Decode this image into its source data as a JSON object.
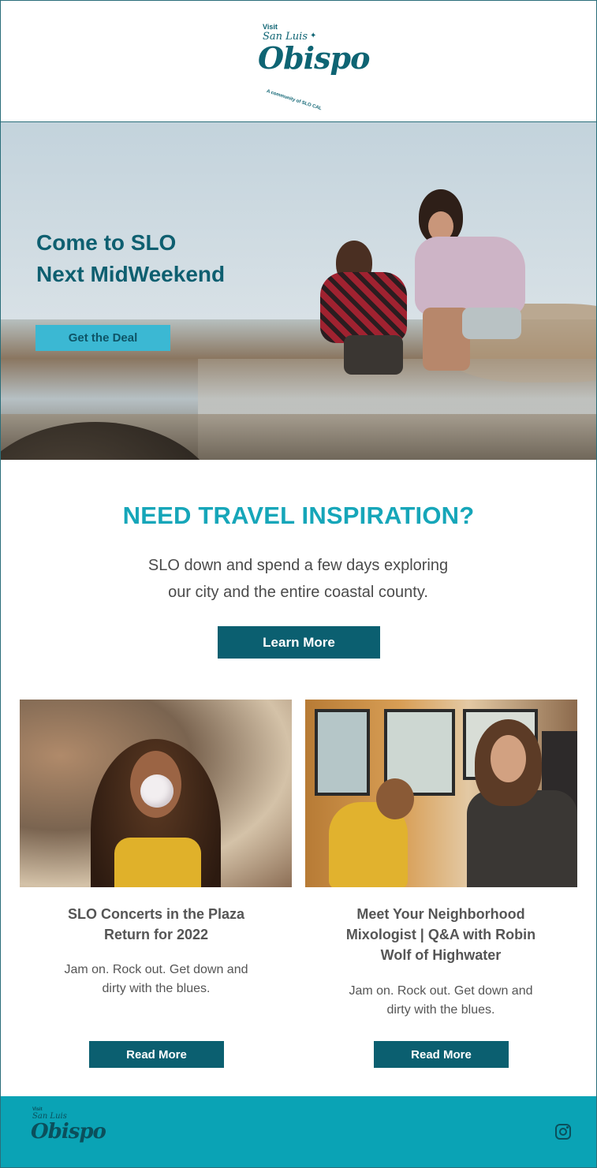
{
  "header": {
    "logo": {
      "visit": "Visit",
      "san_luis": "San Luis",
      "obispo": "Obispo",
      "tagline": "A community of SLO CAL"
    }
  },
  "hero": {
    "title_line1": "Come to SLO",
    "title_line2": "Next MidWeekend",
    "cta_label": "Get the Deal",
    "image": "two-women-at-tide-pools"
  },
  "inspiration": {
    "title": "NEED TRAVEL INSPIRATION?",
    "text_line1": "SLO down and spend a few days exploring",
    "text_line2": "our city and the entire coastal county.",
    "cta_label": "Learn More"
  },
  "cards": [
    {
      "image": "woman-blowing-bubble-gum",
      "title_line1": "SLO Concerts in the Plaza",
      "title_line2": "Return for 2022",
      "desc_line1": "Jam on. Rock out. Get down and",
      "desc_line2": "dirty with the blues.",
      "cta_label": "Read More"
    },
    {
      "image": "mother-and-child-in-trolley",
      "title_line1": "Meet Your Neighborhood",
      "title_line2": "Mixologist | Q&A with Robin",
      "title_line3": "Wolf of Highwater",
      "desc_line1": "Jam on. Rock out. Get down and",
      "desc_line2": "dirty with the blues.",
      "cta_label": "Read More"
    }
  ],
  "footer": {
    "logo": {
      "visit": "Visit",
      "san_luis": "San Luis",
      "obispo": "Obispo"
    },
    "social_icon": "instagram-icon"
  },
  "colors": {
    "brand_dark": "#0b5f70",
    "brand_teal": "#16a6b9",
    "hero_cta": "#3bb8d3",
    "footer_bg": "#0aa3b5"
  }
}
